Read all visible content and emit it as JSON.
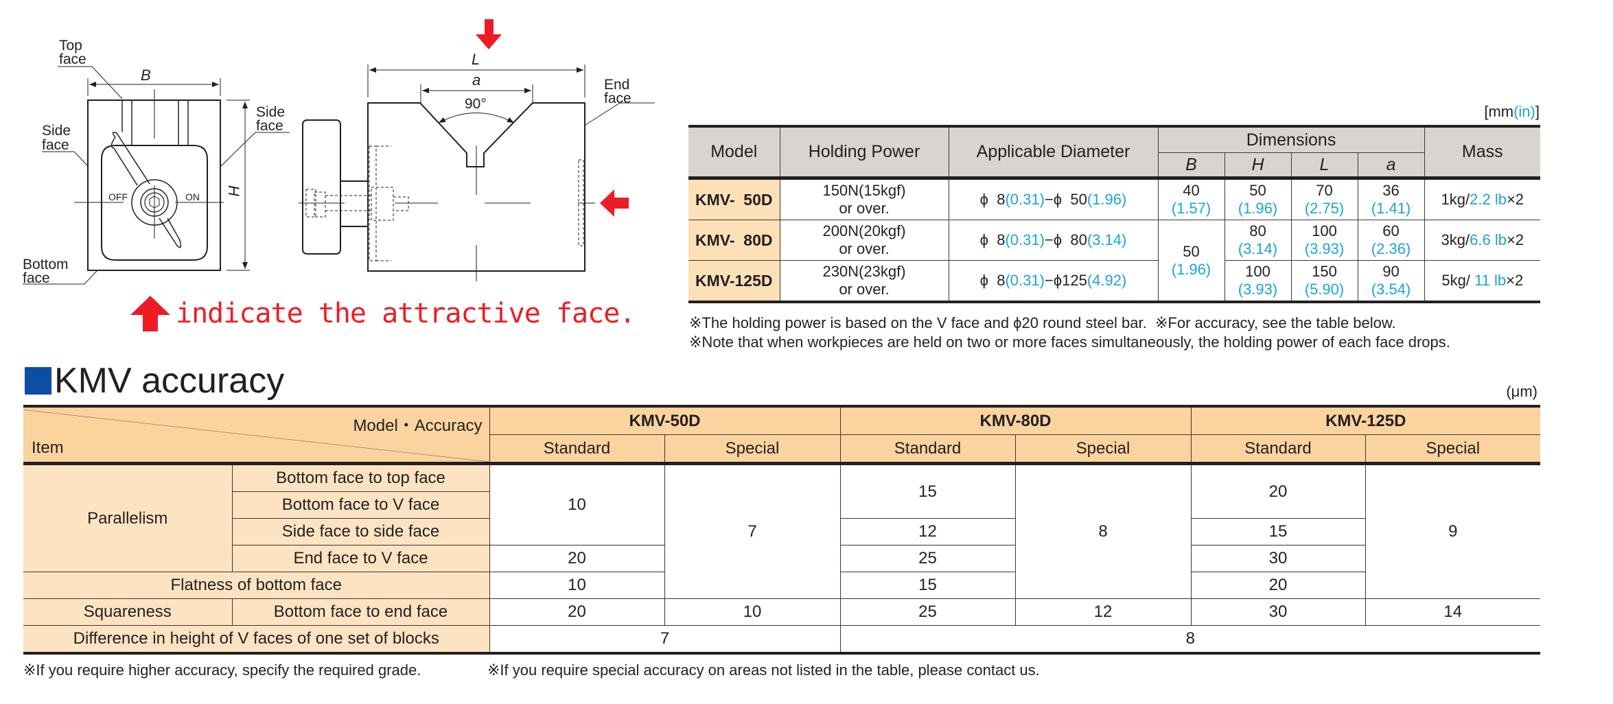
{
  "diagram": {
    "labels": {
      "top_face": [
        "Top",
        "face"
      ],
      "side_face_left": [
        "Side",
        "face"
      ],
      "side_face_right": [
        "Side",
        "face"
      ],
      "bottom_face": [
        "Bottom",
        "face"
      ],
      "end_face": [
        "End",
        "face"
      ],
      "off": "OFF",
      "on": "ON",
      "dim_b": "B",
      "dim_h": "H",
      "dim_l": "L",
      "dim_a": "a",
      "angle": "90°"
    },
    "caption": "indicate the attractive face.",
    "accent_color": "#ed1c24"
  },
  "spec_table": {
    "units": {
      "open": "[mm",
      "in": "(in)",
      "close": "]"
    },
    "headers": {
      "model": "Model",
      "holding_power": "Holding Power",
      "applicable_diameter": "Applicable Diameter",
      "dimensions": "Dimensions",
      "mass": "Mass",
      "dim_cols": [
        "B",
        "H",
        "L",
        "a"
      ]
    },
    "rows": [
      {
        "model": "KMV-  50D",
        "holding_power": [
          "150N(15kgf)",
          "or over."
        ],
        "diameter": {
          "min_mm": "ϕ  8",
          "min_in": "(0.31)",
          "dash": "−",
          "max_mm": "ϕ  50",
          "max_in": "(1.96)"
        },
        "B": {
          "mm": "40",
          "in": "(1.57)"
        },
        "H": {
          "mm": "50",
          "in": "(1.96)"
        },
        "L": {
          "mm": "70",
          "in": "(2.75)"
        },
        "a": {
          "mm": "36",
          "in": "(1.41)"
        },
        "mass": {
          "kg": "1kg/",
          "lb": "2.2 lb",
          "mult": "×2"
        }
      },
      {
        "model": "KMV-  80D",
        "holding_power": [
          "200N(20kgf)",
          "or over."
        ],
        "diameter": {
          "min_mm": "ϕ  8",
          "min_in": "(0.31)",
          "dash": "−",
          "max_mm": "ϕ  80",
          "max_in": "(3.14)"
        },
        "B": {
          "mm": "50",
          "in": "(1.96)"
        },
        "H": {
          "mm": "80",
          "in": "(3.14)"
        },
        "L": {
          "mm": "100",
          "in": "(3.93)"
        },
        "a": {
          "mm": "60",
          "in": "(2.36)"
        },
        "mass": {
          "kg": "3kg/",
          "lb": "6.6 lb",
          "mult": "×2"
        }
      },
      {
        "model": "KMV-125D",
        "holding_power": [
          "230N(23kgf)",
          "or over."
        ],
        "diameter": {
          "min_mm": "ϕ  8",
          "min_in": "(0.31)",
          "dash": "−",
          "max_mm": "ϕ125",
          "max_in": "(4.92)"
        },
        "B": {
          "mm": "50",
          "in": "(1.96)"
        },
        "H": {
          "mm": "100",
          "in": "(3.93)"
        },
        "L": {
          "mm": "150",
          "in": "(5.90)"
        },
        "a": {
          "mm": "90",
          "in": "(3.54)"
        },
        "mass": {
          "kg": "5kg/",
          "lb": " 11 lb",
          "mult": "×2"
        }
      }
    ],
    "notes": [
      "※The holding power is based on the V face and ϕ20 round steel bar.  ※For accuracy, see the table below.",
      "※Note that when workpieces are held on two or more faces simultaneously, the holding power of each face drops."
    ]
  },
  "accuracy": {
    "title": "KMV accuracy",
    "title_marker_color": "#0b4ea2",
    "unit": "(μm)",
    "header": {
      "corner_top": "Model・Accuracy",
      "corner_bottom": "Item",
      "models": [
        "KMV-50D",
        "KMV-80D",
        "KMV-125D"
      ],
      "grades": [
        "Standard",
        "Special",
        "Standard",
        "Special",
        "Standard",
        "Special"
      ]
    },
    "groups": {
      "parallelism": "Parallelism",
      "flatness": "Flatness of bottom face",
      "squareness": "Squareness",
      "height_diff": "Difference in height of V faces of one set of blocks"
    },
    "items": {
      "bottom_to_top": "Bottom face to top face",
      "bottom_to_v": "Bottom face to V face",
      "side_to_side": "Side face to side face",
      "end_to_v": "End face to V face",
      "bottom_to_end": "Bottom face to end face"
    },
    "values": {
      "kmv50_std_parallel_top_v_side": "10",
      "kmv50_std_end_v": "20",
      "kmv50_std_flatness": "10",
      "kmv50_special_parallel_flat": "7",
      "kmv50_std_square": "20",
      "kmv50_special_square": "10",
      "kmv50_height_diff": "7",
      "kmv80_std_top_v": "15",
      "kmv80_std_side": "12",
      "kmv80_std_end_v": "25",
      "kmv80_std_flatness": "15",
      "kmv80_special_parallel_flat": "8",
      "kmv80_std_square": "25",
      "kmv80_special_square": "12",
      "kmv80_125_height_diff": "8",
      "kmv125_std_top_v": "20",
      "kmv125_std_side": "15",
      "kmv125_std_end_v": "30",
      "kmv125_std_flatness": "20",
      "kmv125_special_parallel_flat": "9",
      "kmv125_std_square": "30",
      "kmv125_special_square": "14"
    },
    "notes": [
      "※If you require higher accuracy, specify the required grade.",
      "※If you require special accuracy on areas not listed in the table, please contact us."
    ]
  }
}
